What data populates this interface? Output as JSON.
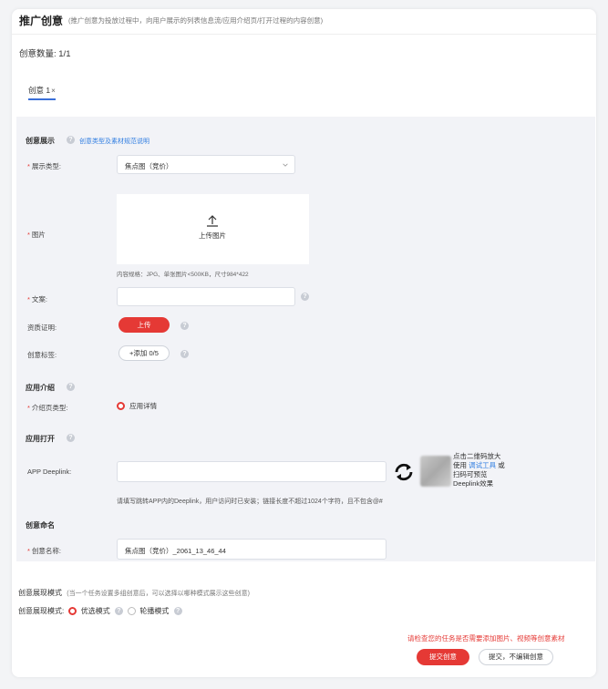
{
  "header": {
    "title": "推广创意",
    "subtitle": "(推广创意为投放过程中，向用户展示的列表信息流/应用介绍页/打开过程的内容创意)"
  },
  "creative_count": "创意数量: 1/1",
  "tab": {
    "label": "创意 1",
    "close": "×"
  },
  "display": {
    "section_title": "创意展示",
    "help_link": "创意类型及素材规范说明",
    "type_label": "展示类型:",
    "type_value": "焦点图（竞价）",
    "image_label": "图片",
    "upload_text": "上传图片",
    "image_hint": "内容规格：JPG、单张图片<500KB，尺寸984*422",
    "copy_label": "文案:",
    "copy_value": "",
    "qualification_label": "资质证明:",
    "upload_button": "上传",
    "tags_label": "创意标签:",
    "add_tag_button": "+添加 0/5"
  },
  "app_intro": {
    "section_title": "应用介绍",
    "page_type_label": "介绍页类型:",
    "page_type_option": "应用详情"
  },
  "app_open": {
    "section_title": "应用打开",
    "deeplink_label": "APP Deeplink:",
    "deeplink_value": "",
    "qr_text_1": "点击二维码放大",
    "qr_text_2": "使用",
    "qr_link": "调试工具",
    "qr_text_3": "或扫码可预览Deeplink效果",
    "deeplink_hint": "请填写跳转APP内的Deeplink，用户访问时已安装；链接长度不超过1024个字符，且不包含@#"
  },
  "naming": {
    "section_title": "创意命名",
    "name_label": "创意名称:",
    "name_value": "焦点图（竞价）_2061_13_46_44"
  },
  "mode": {
    "title": "创意展现模式",
    "subtitle": "(当一个任务设置多组创意后，可以选择以哪种模式展示这些创意)",
    "label": "创意展现模式:",
    "option_1": "优选模式",
    "option_2": "轮播模式"
  },
  "footer": {
    "warning": "请检查您的任务是否需要添加图片、视频等创意素材",
    "submit_button": "提交创意",
    "submit_no_edit_button": "提交，不编辑创意"
  },
  "colors": {
    "accent_red": "#e53935",
    "link_blue": "#2f7de1",
    "tab_blue": "#3a6fd8"
  }
}
